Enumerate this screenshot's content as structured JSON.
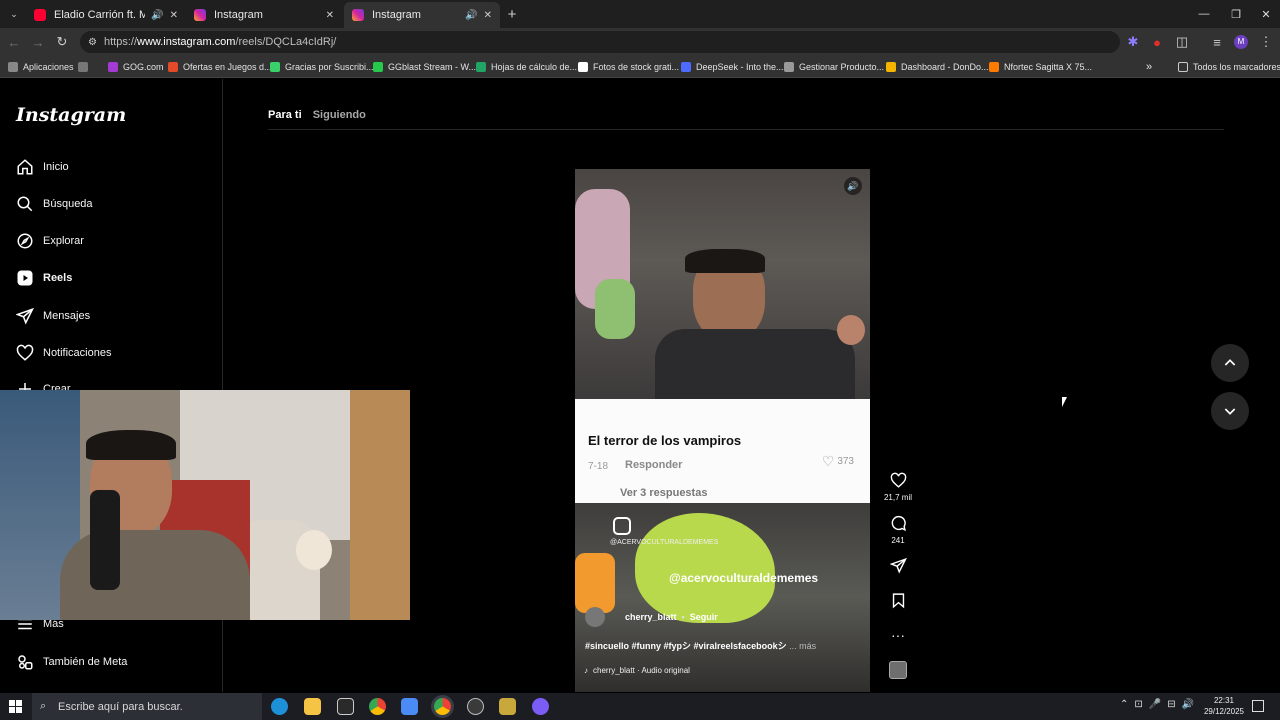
{
  "browser": {
    "tabs": [
      {
        "title": "Eladio Carrión ft. Myke Tow",
        "favicon_color": "#ff0033",
        "audio": true,
        "active": false
      },
      {
        "title": "Instagram",
        "favicon_color": "#d6249f",
        "audio": false,
        "active": false
      },
      {
        "title": "Instagram",
        "favicon_color": "#d6249f",
        "audio": true,
        "active": true
      }
    ],
    "new_tab": "+",
    "url": {
      "scheme": "https://",
      "host": "www.instagram.com",
      "path": "/reels/DQCLa4cIdRj/"
    },
    "bookmarks": [
      {
        "label": "Aplicaciones",
        "color": "#888888"
      },
      {
        "label": "GOG.com",
        "color": "#a23ad3"
      },
      {
        "label": "Ofertas en Juegos d...",
        "color": "#e24a2a"
      },
      {
        "label": "Gracias por Suscribi...",
        "color": "#3ad06a"
      },
      {
        "label": "GGblast Stream - W...",
        "color": "#27c94b"
      },
      {
        "label": "Hojas de cálculo de...",
        "color": "#21a464"
      },
      {
        "label": "Fotos de stock grati...",
        "color": "#ffffff"
      },
      {
        "label": "DeepSeek - Into the...",
        "color": "#4d6bfe"
      },
      {
        "label": "Gestionar Producto...",
        "color": "#999999"
      },
      {
        "label": "Dashboard - DonDo...",
        "color": "#f4b400"
      },
      {
        "label": "Nfortec Sagitta X 75...",
        "color": "#ff7a00"
      }
    ],
    "bookmarks_more": "»",
    "all_bookmarks": "Todos los marcadores"
  },
  "sidebar": {
    "logo": "Instagram",
    "items": [
      {
        "label": "Inicio",
        "icon": "home-icon"
      },
      {
        "label": "Búsqueda",
        "icon": "search-icon"
      },
      {
        "label": "Explorar",
        "icon": "compass-icon"
      },
      {
        "label": "Reels",
        "icon": "reels-icon"
      },
      {
        "label": "Mensajes",
        "icon": "send-icon"
      },
      {
        "label": "Notificaciones",
        "icon": "heart-icon"
      },
      {
        "label": "Crear",
        "icon": "plus-icon"
      },
      {
        "label": "Más",
        "icon": "menu-icon"
      },
      {
        "label": "También de Meta",
        "icon": "meta-icon"
      }
    ]
  },
  "feed_tabs": {
    "for_you": "Para ti",
    "following": "Siguiendo"
  },
  "reel": {
    "comment": {
      "text": "El terror de los vampiros",
      "time": "7-18",
      "reply": "Responder",
      "likes": "373",
      "more_replies": "Ver 3 respuestas"
    },
    "watermark_small": "@ACERVOCULTURALDEMEMES",
    "watermark_large": "@acervoculturaldememes",
    "author": "cherry_blatt",
    "follow": "Seguir",
    "caption": "#sincuello #funny #fypシ #viralreelsfacebookシ",
    "caption_more": "... más",
    "audio": "cherry_blatt · Audio original"
  },
  "actions": {
    "likes": "21,7 mil",
    "comments": "241"
  },
  "taskbar": {
    "search_placeholder": "Escribe aquí para buscar.",
    "time": "22:31",
    "date": "29/12/2025"
  }
}
